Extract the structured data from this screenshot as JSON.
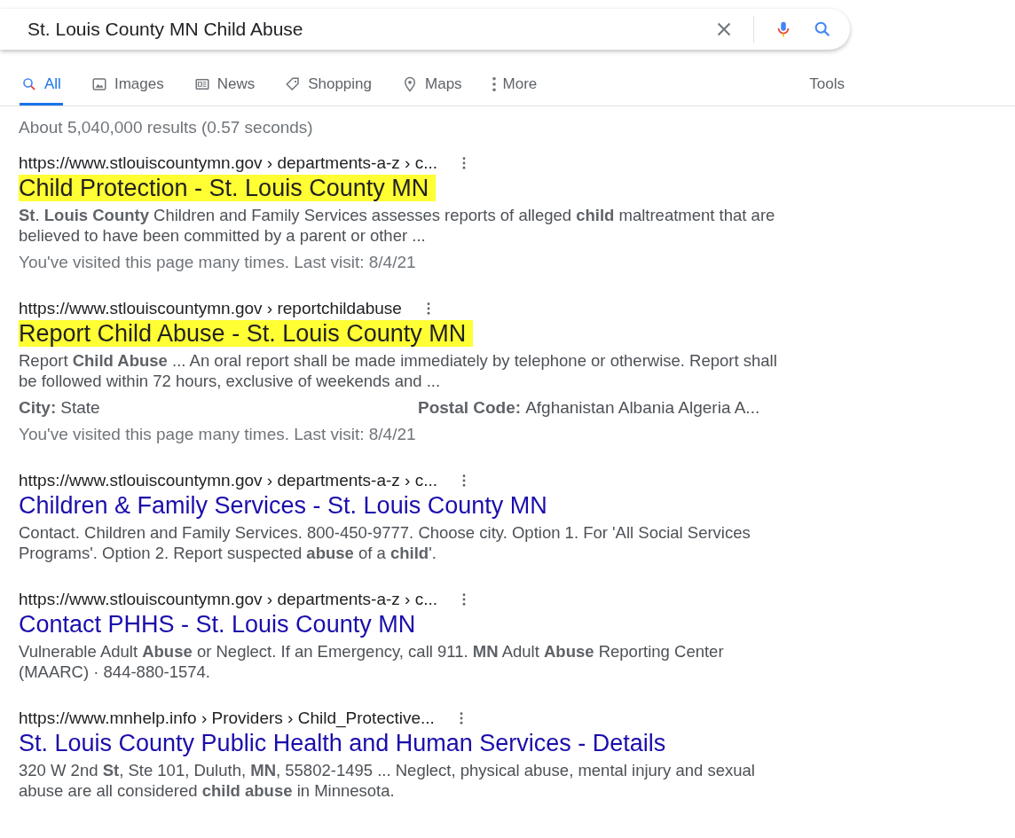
{
  "search": {
    "query": "St. Louis County MN Child Abuse"
  },
  "tabs": [
    {
      "label": "All",
      "kind": "all",
      "selected": true
    },
    {
      "label": "Images",
      "kind": "images",
      "selected": false
    },
    {
      "label": "News",
      "kind": "news",
      "selected": false
    },
    {
      "label": "Shopping",
      "kind": "shopping",
      "selected": false
    },
    {
      "label": "Maps",
      "kind": "maps",
      "selected": false
    },
    {
      "label": "More",
      "kind": "more",
      "selected": false
    }
  ],
  "tools": "Tools",
  "result_stats": "About 5,040,000 results (0.57 seconds)",
  "results": [
    {
      "url": "https://www.stlouiscountymn.gov › departments-a-z › c...",
      "title": "Child Protection - St. Louis County MN",
      "highlighted": true,
      "snippet": "**St**. **Louis County** Children and Family Services assesses reports of alleged **child** maltreatment that are believed to have been committed by a parent or other ...",
      "visited": "You've visited this page many times. Last visit: 8/4/21"
    },
    {
      "url": "https://www.stlouiscountymn.gov › reportchildabuse",
      "title": "Report Child Abuse - St. Louis County MN",
      "highlighted": true,
      "snippet": "Report **Child Abuse** ... An oral report shall be made immediately by telephone or otherwise. Report shall be followed within 72 hours, exclusive of weekends and ...",
      "fields": [
        {
          "label": "City:",
          "value": "State"
        },
        {
          "label": "Postal Code:",
          "value": "Afghanistan Albania Algeria A..."
        }
      ],
      "visited": "You've visited this page many times. Last visit: 8/4/21"
    },
    {
      "url": "https://www.stlouiscountymn.gov › departments-a-z › c...",
      "title": "Children & Family Services - St. Louis County MN",
      "highlighted": false,
      "snippet": "Contact. Children and Family Services. 800-450-9777. Choose city. Option 1. For 'All Social Services Programs'. Option 2. Report suspected **abuse** of a **child**'."
    },
    {
      "url": "https://www.stlouiscountymn.gov › departments-a-z › c...",
      "title": "Contact PHHS - St. Louis County MN",
      "highlighted": false,
      "snippet": "Vulnerable Adult **Abuse** or Neglect. If an Emergency, call 911. **MN** Adult **Abuse** Reporting Center (MAARC) · 844-880-1574."
    },
    {
      "url": "https://www.mnhelp.info › Providers › Child_Protective...",
      "title": "St. Louis County Public Health and Human Services - Details",
      "highlighted": false,
      "snippet": "320 W 2nd **St**, Ste 101, Duluth, **MN**, 55802-1495 ... Neglect, physical abuse, mental injury and sexual abuse are all considered **child abuse** in Minnesota."
    }
  ]
}
